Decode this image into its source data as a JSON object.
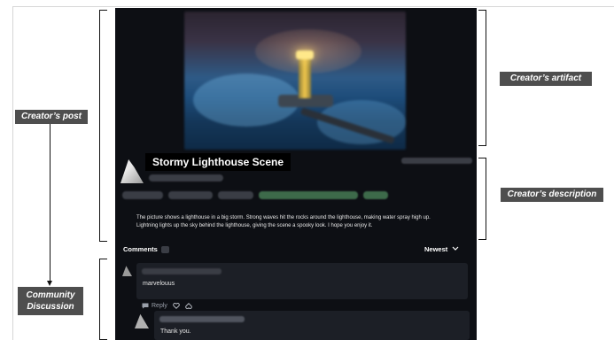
{
  "annotations": {
    "creators_post": "Creator’s post",
    "community_discussion_line1": "Community",
    "community_discussion_line2": "Discussion",
    "creators_artifact": "Creator’s artifact",
    "creators_description": "Creator’s description"
  },
  "post": {
    "title": "Stormy Lighthouse Scene",
    "description": "The picture shows a lighthouse in a big storm. Strong waves hit the rocks around the lighthouse, making water spray high up. Lightning lights up the sky behind the lighthouse, giving the scene a spooky look. I hope you enjoy it."
  },
  "comments": {
    "header": "Comments",
    "sort_label": "Newest",
    "items": [
      {
        "text": "marvelouus"
      }
    ],
    "actions": {
      "reply_label": "Reply"
    },
    "replies": [
      {
        "text": "Thank you."
      }
    ]
  },
  "colors": {
    "panel_bg": "#0d0f14",
    "comment_bg": "#1c1f26",
    "label_bg": "#4e4e4e"
  }
}
